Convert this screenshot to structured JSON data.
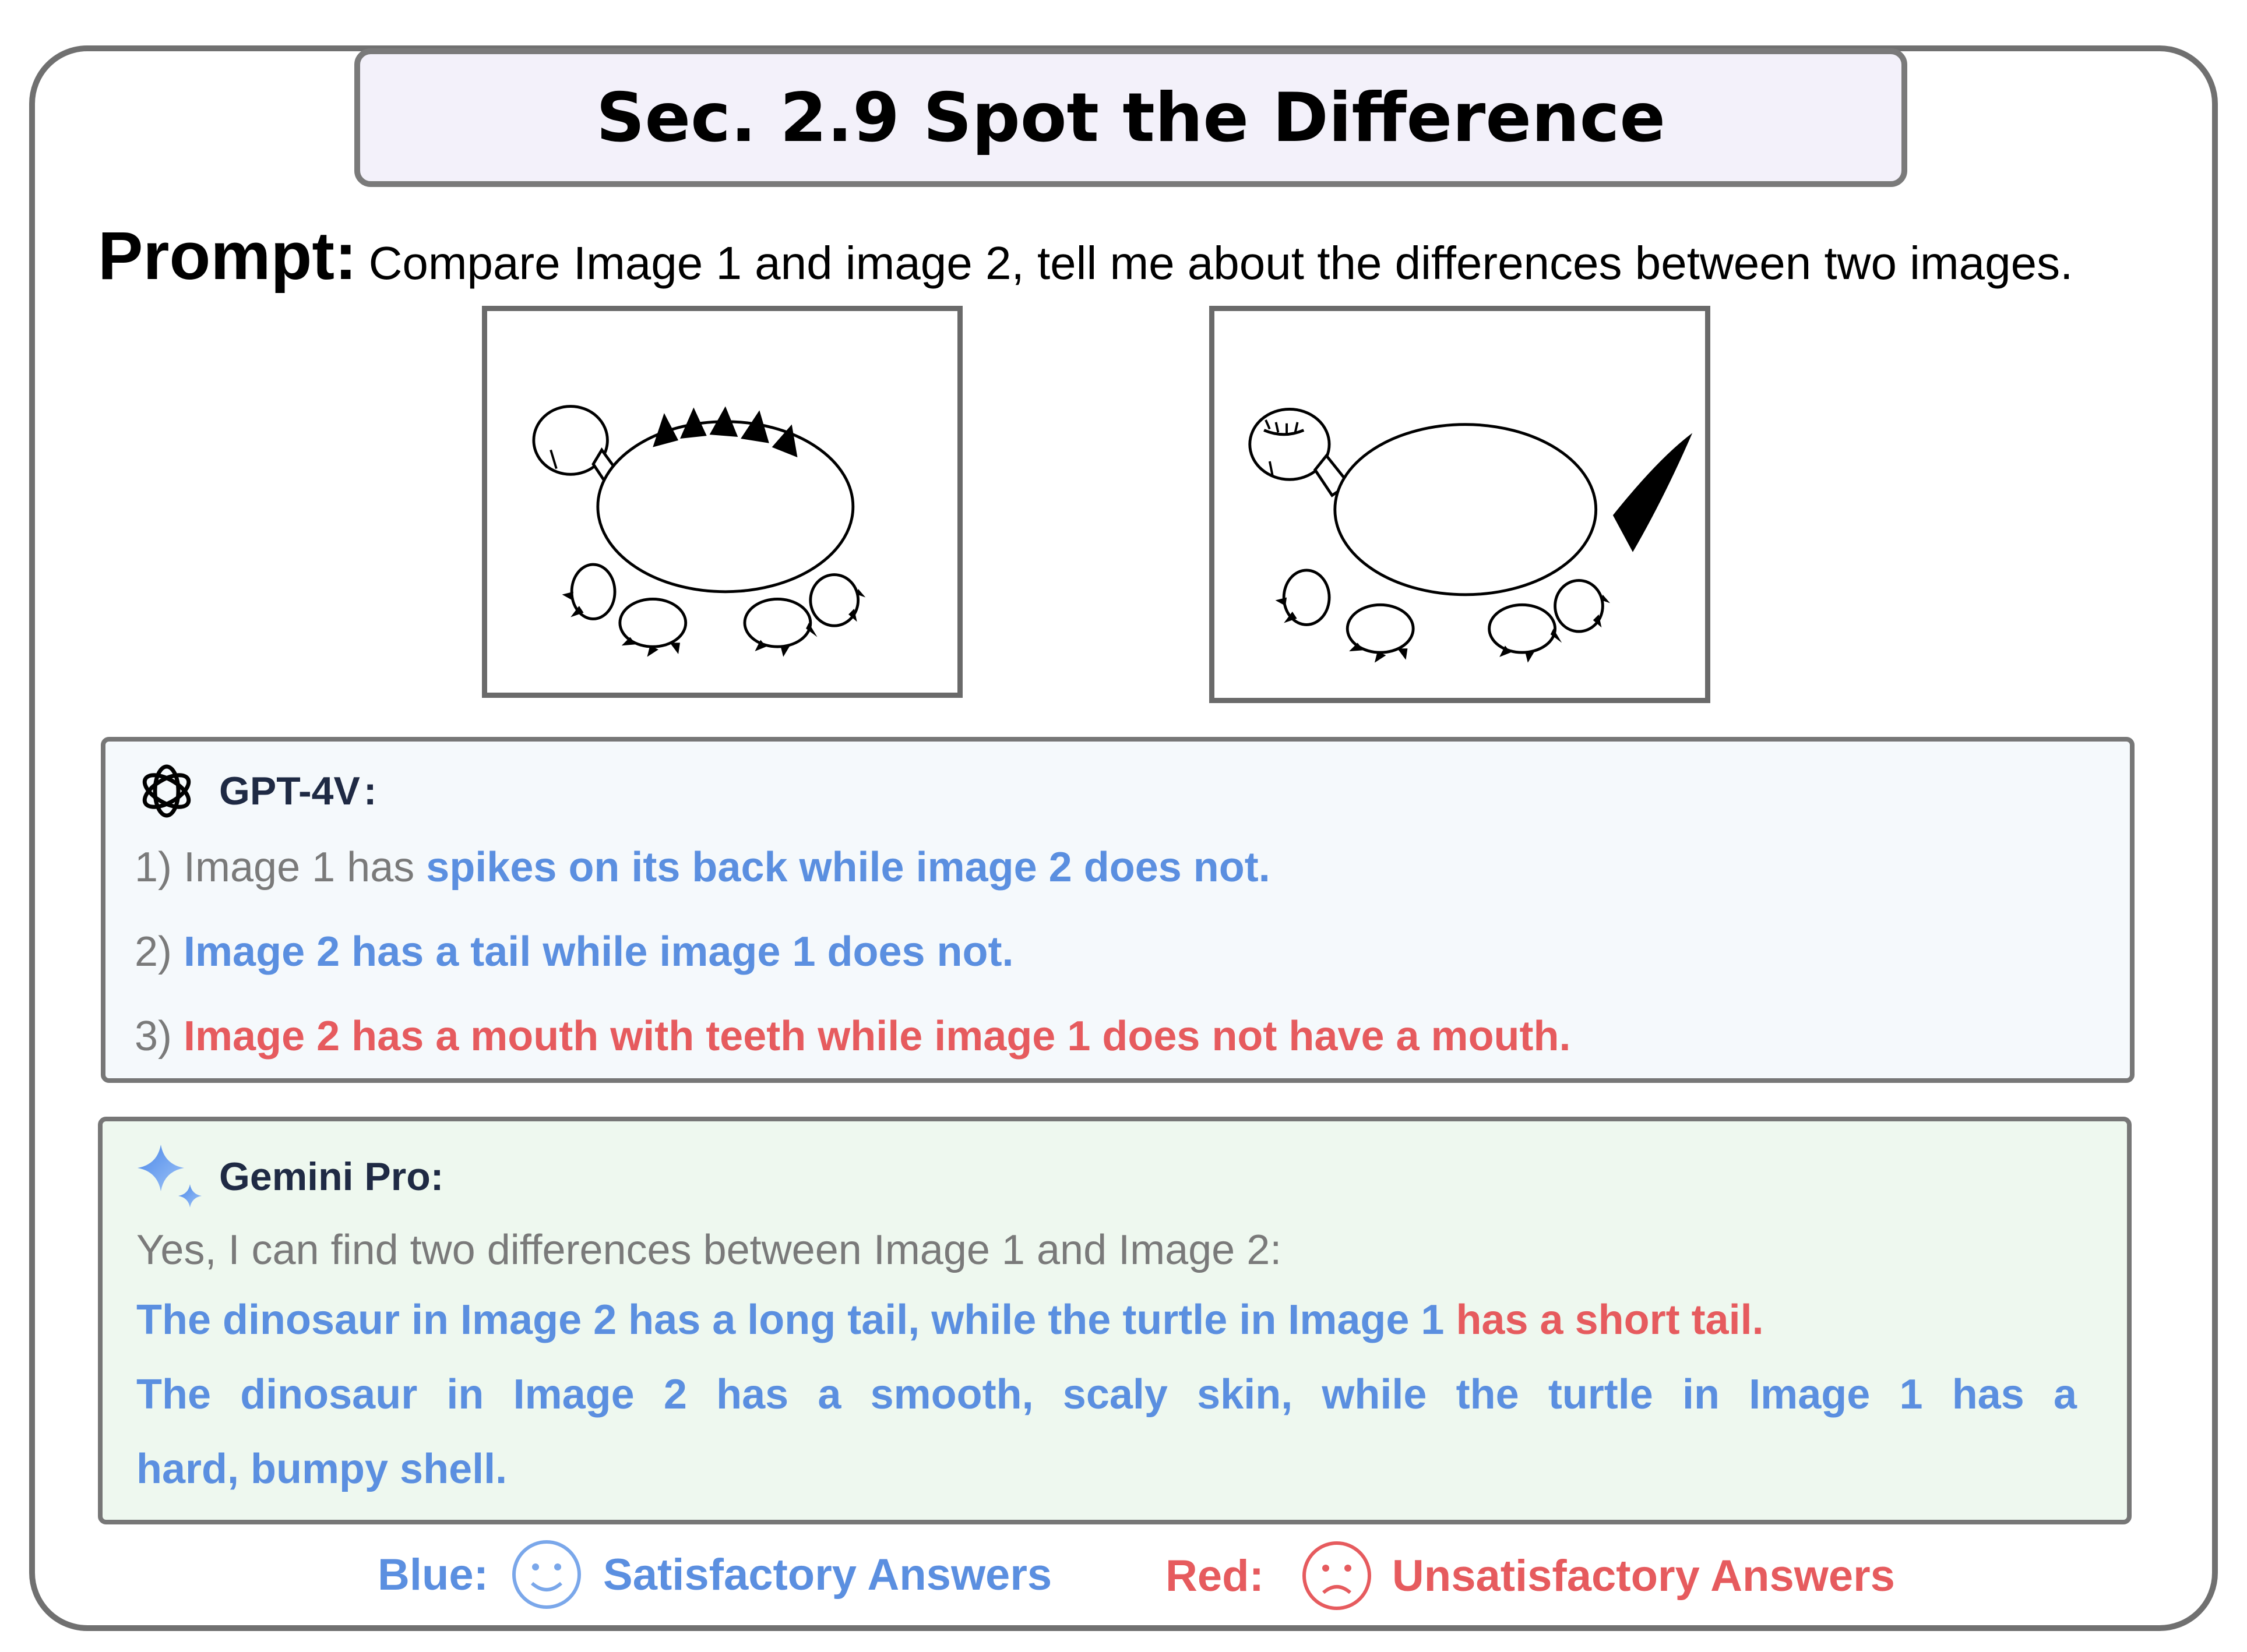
{
  "title": "Sec. 2.9 Spot the Difference",
  "prompt": {
    "label": "Prompt:",
    "text": "Compare Image 1 and image 2, tell me about the differences between two images."
  },
  "gpt": {
    "name": "GPT-4V",
    "colon": ":",
    "items": [
      {
        "prefix": "1) Image 1 has ",
        "answer": "spikes on its back while image 2 does not."
      },
      {
        "prefix": "2) ",
        "answer": "Image 2 has a tail while image 1 does not."
      },
      {
        "prefix": "3) ",
        "answer": "Image 2 has a mouth with teeth while image 1 does not have a mouth."
      }
    ]
  },
  "gemini": {
    "name": "Gemini Pro:",
    "intro": "Yes, I can find two differences between Image 1 and Image 2:",
    "line1_blue": "The dinosaur in Image 2 has a long tail, while the turtle in Image 1 ",
    "line1_red": "has a short tail.",
    "line2": "The dinosaur in Image 2 has a smooth, scaly skin, while the turtle in Image 1 has a",
    "line3": "hard, bumpy shell."
  },
  "legend": {
    "blue_label": "Blue:",
    "blue_text": "Satisfactory Answers",
    "red_label": "Red:",
    "red_text": "Unsatisfactory Answers"
  },
  "colors": {
    "blue": "#5b8fe0",
    "red": "#e65b5e",
    "gpt_bg": "#f5f9fc",
    "gemini_bg": "#eef8ef",
    "title_bg": "#f3f1fa"
  },
  "icons": {
    "gpt": "openai-logo-icon",
    "gemini": "gemini-sparkle-icon",
    "happy": "smiley-face-icon",
    "sad": "sad-face-icon"
  }
}
